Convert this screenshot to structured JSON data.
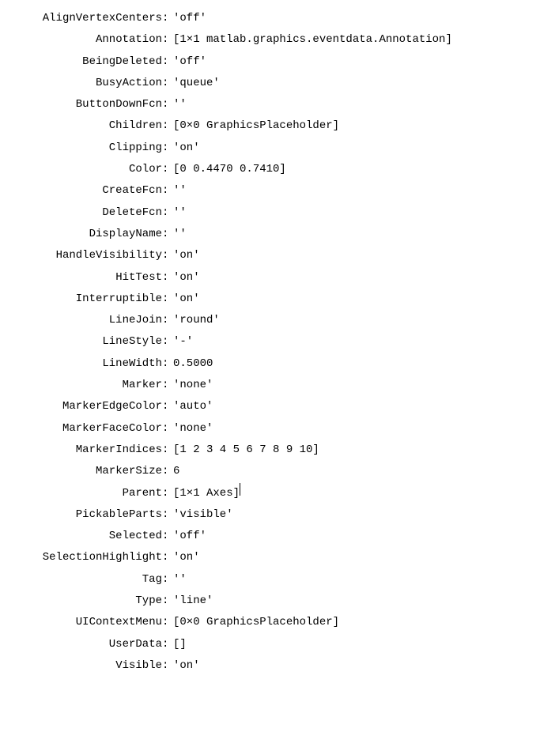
{
  "props": [
    {
      "name": "AlignVertexCenters",
      "value": "'off'"
    },
    {
      "name": "Annotation",
      "value": "[1×1 matlab.graphics.eventdata.Annotation]"
    },
    {
      "name": "BeingDeleted",
      "value": "'off'"
    },
    {
      "name": "BusyAction",
      "value": "'queue'"
    },
    {
      "name": "ButtonDownFcn",
      "value": "''"
    },
    {
      "name": "Children",
      "value": "[0×0 GraphicsPlaceholder]"
    },
    {
      "name": "Clipping",
      "value": "'on'"
    },
    {
      "name": "Color",
      "value": "[0 0.4470 0.7410]"
    },
    {
      "name": "CreateFcn",
      "value": "''"
    },
    {
      "name": "DeleteFcn",
      "value": "''"
    },
    {
      "name": "DisplayName",
      "value": "''"
    },
    {
      "name": "HandleVisibility",
      "value": "'on'"
    },
    {
      "name": "HitTest",
      "value": "'on'"
    },
    {
      "name": "Interruptible",
      "value": "'on'"
    },
    {
      "name": "LineJoin",
      "value": "'round'"
    },
    {
      "name": "LineStyle",
      "value": "'-'"
    },
    {
      "name": "LineWidth",
      "value": "0.5000"
    },
    {
      "name": "Marker",
      "value": "'none'"
    },
    {
      "name": "MarkerEdgeColor",
      "value": "'auto'"
    },
    {
      "name": "MarkerFaceColor",
      "value": "'none'"
    },
    {
      "name": "MarkerIndices",
      "value": "[1 2 3 4 5 6 7 8 9 10]"
    },
    {
      "name": "MarkerSize",
      "value": "6"
    },
    {
      "name": "Parent",
      "value": "[1×1 Axes]",
      "cursor": true
    },
    {
      "name": "PickableParts",
      "value": "'visible'"
    },
    {
      "name": "Selected",
      "value": "'off'"
    },
    {
      "name": "SelectionHighlight",
      "value": "'on'"
    },
    {
      "name": "Tag",
      "value": "''"
    },
    {
      "name": "Type",
      "value": "'line'"
    },
    {
      "name": "UIContextMenu",
      "value": "[0×0 GraphicsPlaceholder]"
    },
    {
      "name": "UserData",
      "value": "[]"
    },
    {
      "name": "Visible",
      "value": "'on'"
    }
  ]
}
